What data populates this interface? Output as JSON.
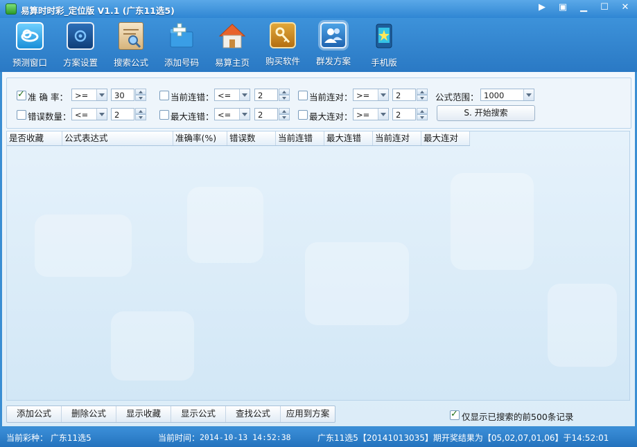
{
  "window": {
    "title": "易算时时彩_定位版 V1.1 (广东11选5)",
    "controls": [
      "▶",
      "▣",
      "▁",
      "☐",
      "✕"
    ]
  },
  "toolbar": {
    "items": [
      {
        "label": "预测窗口",
        "icon": "cloud-icon"
      },
      {
        "label": "方案设置",
        "icon": "settings-screen-icon"
      },
      {
        "label": "搜索公式",
        "icon": "search-formula-icon"
      },
      {
        "label": "添加号码",
        "icon": "add-folder-icon"
      },
      {
        "label": "易算主页",
        "icon": "home-icon"
      },
      {
        "label": "购买软件",
        "icon": "key-icon"
      },
      {
        "label": "群发方案",
        "icon": "users-icon"
      },
      {
        "label": "手机版",
        "icon": "mobile-icon"
      }
    ]
  },
  "filters": {
    "accuracy": {
      "label": "准 确 率：",
      "op": ">=",
      "value": "30",
      "checked": true
    },
    "errors": {
      "label": "错误数量：",
      "op": "<=",
      "value": "2",
      "checked": false
    },
    "cur_err": {
      "label": "当前连错：",
      "op": "<=",
      "value": "2",
      "checked": false
    },
    "max_err": {
      "label": "最大连错：",
      "op": "<=",
      "value": "2",
      "checked": false
    },
    "cur_ok": {
      "label": "当前连对：",
      "op": ">=",
      "value": "2",
      "checked": false
    },
    "max_ok": {
      "label": "最大连对：",
      "op": ">=",
      "value": "2",
      "checked": false
    },
    "range": {
      "label": "公式范围：",
      "value": "1000"
    },
    "search_button": "S. 开始搜索"
  },
  "grid": {
    "columns": [
      "是否收藏",
      "公式表达式",
      "准确率(%)",
      "错误数",
      "当前连错",
      "最大连错",
      "当前连对",
      "最大连对"
    ]
  },
  "actions": {
    "buttons": [
      "添加公式",
      "删除公式",
      "显示收藏",
      "显示公式",
      "查找公式",
      "应用到方案"
    ],
    "only_top": {
      "label": "仅显示已搜索的前500条记录",
      "checked": true
    }
  },
  "status": {
    "lottery": "当前彩种：  广东11选5",
    "time_label": "当前时间：",
    "time_value": "2014-10-13 14:52:38",
    "result": "广东11选5【20141013035】期开奖结果为【05,02,07,01,06】于14:52:01"
  },
  "colors": {
    "accent": "#2f86d3",
    "bg": "#e6f2fb"
  }
}
